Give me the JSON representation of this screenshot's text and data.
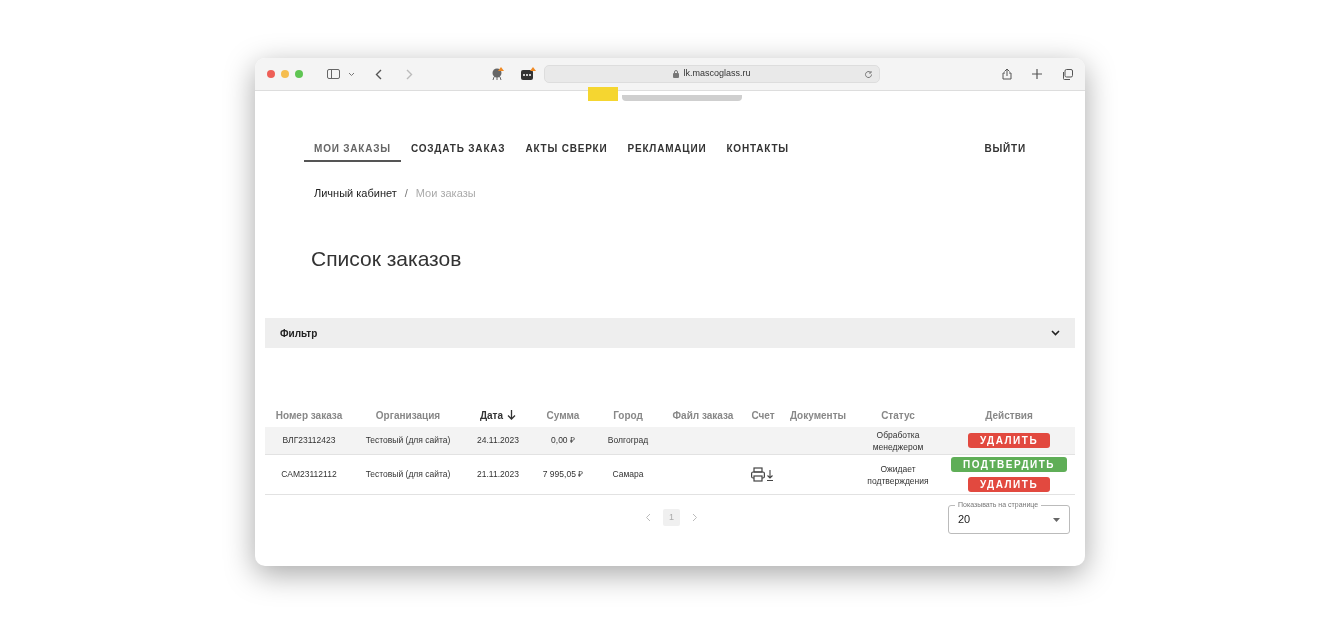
{
  "browser": {
    "url": "lk.mascoglass.ru"
  },
  "nav": {
    "items": [
      {
        "label": "МОИ ЗАКАЗЫ",
        "selected": true
      },
      {
        "label": "СОЗДАТЬ ЗАКАЗ",
        "selected": false
      },
      {
        "label": "АКТЫ СВЕРКИ",
        "selected": false
      },
      {
        "label": "РЕКЛАМАЦИИ",
        "selected": false
      },
      {
        "label": "КОНТАКТЫ",
        "selected": false
      }
    ],
    "logout": "ВЫЙТИ"
  },
  "breadcrumbs": {
    "items": [
      "Личный кабинет",
      "Мои заказы"
    ],
    "separator": "/"
  },
  "title": "Список заказов",
  "filter": {
    "label": "Фильтр",
    "expanded": false
  },
  "table": {
    "columns": [
      {
        "label": "Номер заказа",
        "sorted": false
      },
      {
        "label": "Организация",
        "sorted": false
      },
      {
        "label": "Дата",
        "sorted": true
      },
      {
        "label": "Сумма",
        "sorted": false
      },
      {
        "label": "Город",
        "sorted": false
      },
      {
        "label": "Файл заказа",
        "sorted": false
      },
      {
        "label": "Счет",
        "sorted": false
      },
      {
        "label": "Документы",
        "sorted": false
      },
      {
        "label": "Статус",
        "sorted": false
      },
      {
        "label": "Действия",
        "sorted": false
      }
    ],
    "rows": [
      {
        "selected": true,
        "number": "ВЛГ23112423",
        "organization": "Тестовый (для сайта)",
        "date": "24.11.2023",
        "sum": "0,00 ₽",
        "city": "Волгоград",
        "invoice": false,
        "status": "Обработка менеджером",
        "actions": [
          {
            "kind": "delete",
            "label": "УДАЛИТЬ"
          }
        ]
      },
      {
        "selected": false,
        "number": "САМ23112112",
        "organization": "Тестовый (для сайта)",
        "date": "21.11.2023",
        "sum": "7 995,05 ₽",
        "city": "Самара",
        "invoice": true,
        "status": "Ожидает подтверждения",
        "actions": [
          {
            "kind": "confirm",
            "label": "ПОДТВЕРДИТЬ"
          },
          {
            "kind": "delete",
            "label": "УДАЛИТЬ"
          }
        ]
      }
    ]
  },
  "pagination": {
    "pages": [
      {
        "label": "1",
        "selected": true
      }
    ]
  },
  "page_size": {
    "label": "Показывать на странице",
    "value": "20"
  }
}
